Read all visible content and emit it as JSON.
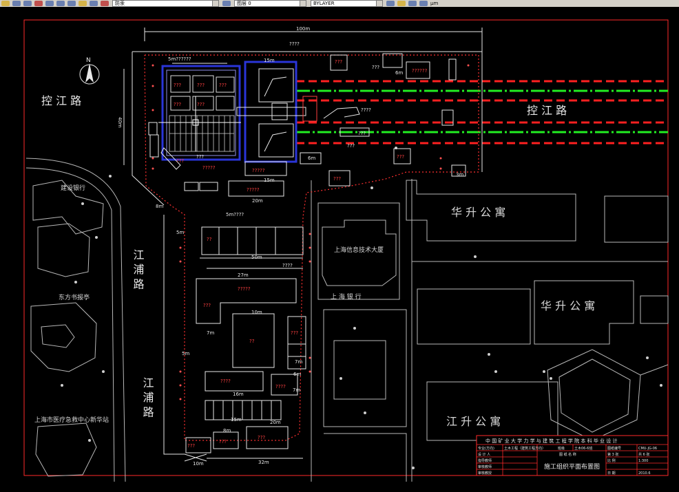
{
  "toolbar": {
    "layer_combo": "防汞",
    "linetype_combo": "图层 0",
    "lineweight_combo": "BYLAYER",
    "unit_label": "µm"
  },
  "roads": {
    "road_left_top": "控 江 路",
    "road_right": "控 江 路",
    "road_left_mid": "江 浦 路",
    "road_left_bottom": "江 浦 路"
  },
  "buildings": {
    "hs_top": "华 升 公 寓",
    "hs_right": "华 升 公 寓",
    "js_bottom": "江 升 公 寓",
    "info_bldg": "上海信息技术大厦",
    "sh_bank": "上 海 银 行",
    "ccb": "建设银行",
    "df_news": "东方书报亭",
    "medical": "上海市医疗急救中心新华站"
  },
  "north": "N",
  "dims": {
    "top_100m": "100m",
    "top_5m_q": "5m??????",
    "d_40m": "40m",
    "d_15m_a": "15m",
    "d_15m_b": "15m",
    "d_20m_a": "20m",
    "d_6m_a": "6m",
    "d_6m_b": "6m",
    "d_8m_a": "8m",
    "d_5m_q": "5m????",
    "d_5m_side": "5m",
    "d_50m": "50m",
    "d_27m": "27m",
    "d_10m": "10m",
    "d_7m_a": "7m",
    "d_7m_b": "7m",
    "d_6m_c": "6m",
    "d_16m": "16m",
    "d_15m_c": "15m",
    "d_20m_b": "20m",
    "d_8m_b": "8m",
    "d_10m_b": "10m",
    "d_32m": "32m",
    "d_5m_side2": "5m",
    "d_3m": "3m",
    "d_7m_c": "7m"
  },
  "labels": {
    "q1": "???",
    "q2": "???",
    "q3": "???",
    "q4": "???",
    "q5": "???",
    "q6": "???",
    "q7": "??????",
    "q8": "?????",
    "q9": "?????",
    "q10": "?????",
    "q11": "???",
    "q12": "???",
    "q13": "???",
    "q14": "?????",
    "q15": "???",
    "q16": "??",
    "q17": "????",
    "q18": "???",
    "q19": "???",
    "q20": "???",
    "q21": "???",
    "q22": "????",
    "q23": "???",
    "q24": "????",
    "q25": "???",
    "q26": "????",
    "q27": "???",
    "q28": "??",
    "q29": "????",
    "q30": "???",
    "q31": "???"
  },
  "title_block": {
    "title": "中 国 矿 业 大 学 力 学 与 建 筑 工 程 学 院 本 科 毕 业 设 计",
    "r1c1": "专业(方向)",
    "r1c2": "土木工程（建筑工程方向）",
    "r1c3": "班级",
    "r1c4": "土木06-6班",
    "r1c5": "图纸编号",
    "r1c6": "CMU-JG-06",
    "r2c1": "设 计 人",
    "r2c3": "图 纸 名 称",
    "r2c5": "第 3 张",
    "r2c6": "共 6 张",
    "r3c1": "指导教师",
    "r3c5": "比 例",
    "r3c6": "1:300",
    "r4c1": "审核教师",
    "drawing_name": "施工组织平面布置图",
    "r5c1": "审核教授",
    "r5c5": "日 期",
    "r5c6": "2010.6"
  },
  "colors": {
    "frame": "#ff2a2a",
    "road_red": "#ff2020",
    "road_green": "#22ee22",
    "building_blue": "#2a35d8",
    "line_white": "#e8e8e8",
    "line_grey": "#bdbdbd"
  }
}
